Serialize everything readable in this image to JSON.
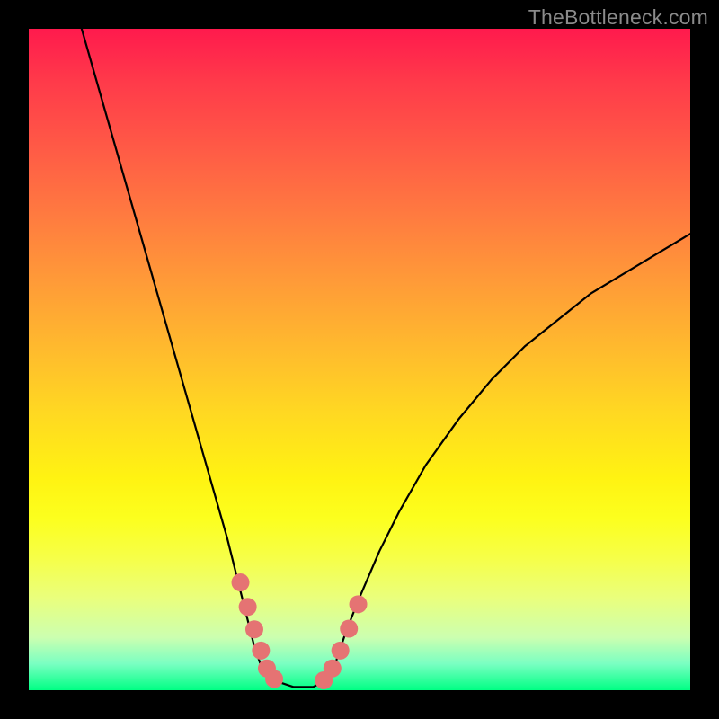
{
  "watermark": "TheBottleneck.com",
  "colors": {
    "curve_stroke": "#000000",
    "marker_fill": "#e57373",
    "marker_stroke": "#d06464",
    "frame_bg": "#000000",
    "gradient_top": "#ff1a4d",
    "gradient_bottom": "#00ff84"
  },
  "chart_data": {
    "type": "line",
    "title": "",
    "xlabel": "",
    "ylabel": "",
    "xlim": [
      0,
      1
    ],
    "ylim": [
      0,
      1
    ],
    "grid": false,
    "legend": false,
    "series": [
      {
        "name": "curve",
        "x": [
          0.08,
          0.1,
          0.12,
          0.14,
          0.16,
          0.18,
          0.2,
          0.22,
          0.24,
          0.26,
          0.28,
          0.3,
          0.31,
          0.32,
          0.33,
          0.34,
          0.35,
          0.37,
          0.4,
          0.43,
          0.45,
          0.46,
          0.47,
          0.48,
          0.5,
          0.53,
          0.56,
          0.6,
          0.65,
          0.7,
          0.75,
          0.8,
          0.85,
          0.9,
          0.95,
          1.0
        ],
        "y": [
          1.0,
          0.93,
          0.86,
          0.79,
          0.72,
          0.65,
          0.58,
          0.51,
          0.44,
          0.37,
          0.3,
          0.23,
          0.19,
          0.15,
          0.11,
          0.07,
          0.04,
          0.015,
          0.005,
          0.005,
          0.015,
          0.03,
          0.06,
          0.09,
          0.14,
          0.21,
          0.27,
          0.34,
          0.41,
          0.47,
          0.52,
          0.56,
          0.6,
          0.63,
          0.66,
          0.69
        ]
      }
    ],
    "markers": {
      "left_cluster": [
        [
          0.32,
          0.163
        ],
        [
          0.331,
          0.126
        ],
        [
          0.341,
          0.092
        ],
        [
          0.351,
          0.06
        ],
        [
          0.36,
          0.033
        ],
        [
          0.371,
          0.017
        ]
      ],
      "right_cluster": [
        [
          0.446,
          0.015
        ],
        [
          0.459,
          0.033
        ],
        [
          0.471,
          0.06
        ],
        [
          0.484,
          0.093
        ],
        [
          0.498,
          0.13
        ]
      ]
    }
  }
}
